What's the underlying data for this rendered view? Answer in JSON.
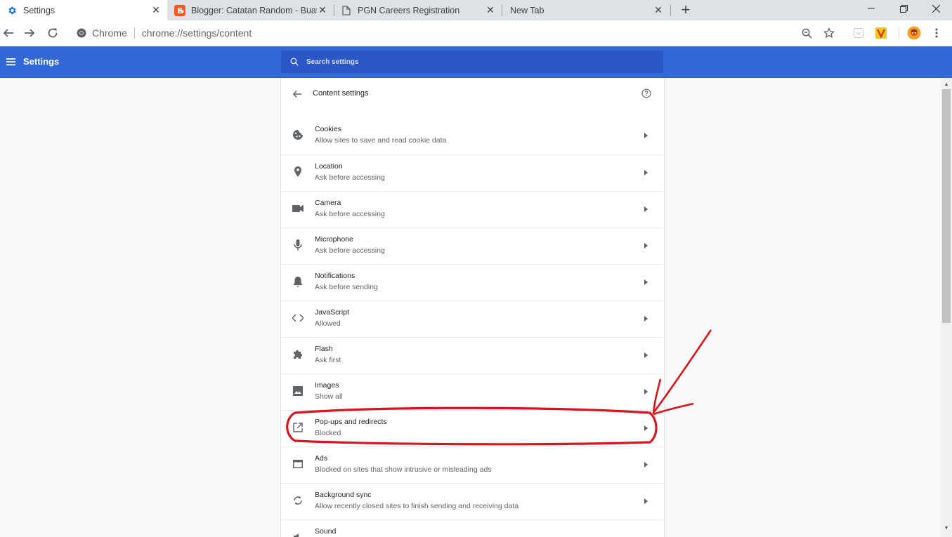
{
  "tabs": [
    {
      "title": "Settings",
      "icon": "gear-icon"
    },
    {
      "title": "Blogger: Catatan Random - Buat",
      "icon": "blogger-icon"
    },
    {
      "title": "PGN Careers Registration",
      "icon": "page-icon"
    },
    {
      "title": "New Tab",
      "icon": "none"
    }
  ],
  "toolbar": {
    "origin": "Chrome",
    "url": "chrome://settings/content"
  },
  "header": {
    "title": "Settings",
    "search_placeholder": "Search settings"
  },
  "content": {
    "title": "Content settings",
    "items": [
      {
        "label": "Cookies",
        "sub": "Allow sites to save and read cookie data",
        "icon": "cookie-icon"
      },
      {
        "label": "Location",
        "sub": "Ask before accessing",
        "icon": "location-pin-icon"
      },
      {
        "label": "Camera",
        "sub": "Ask before accessing",
        "icon": "camera-icon"
      },
      {
        "label": "Microphone",
        "sub": "Ask before accessing",
        "icon": "microphone-icon"
      },
      {
        "label": "Notifications",
        "sub": "Ask before sending",
        "icon": "bell-icon"
      },
      {
        "label": "JavaScript",
        "sub": "Allowed",
        "icon": "code-icon"
      },
      {
        "label": "Flash",
        "sub": "Ask first",
        "icon": "puzzle-icon"
      },
      {
        "label": "Images",
        "sub": "Show all",
        "icon": "image-icon"
      },
      {
        "label": "Pop-ups and redirects",
        "sub": "Blocked",
        "icon": "open-external-icon"
      },
      {
        "label": "Ads",
        "sub": "Blocked on sites that show intrusive or misleading ads",
        "icon": "ads-icon"
      },
      {
        "label": "Background sync",
        "sub": "Allow recently closed sites to finish sending and receiving data",
        "icon": "sync-icon"
      },
      {
        "label": "Sound",
        "sub": "",
        "icon": "speaker-icon"
      }
    ]
  },
  "colors": {
    "header_blue": "#3367d6",
    "annotation_red": "#d9141e"
  }
}
